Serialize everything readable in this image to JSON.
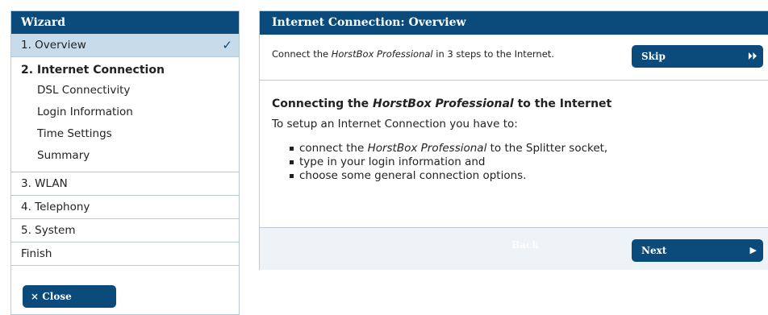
{
  "wizard": {
    "title": "Wizard",
    "steps": [
      {
        "label": "1. Overview",
        "check": "✓"
      },
      {
        "label": "2. Internet Connection",
        "subs": [
          "DSL Connectivity",
          "Login Information",
          "Time Settings",
          "Summary"
        ]
      },
      {
        "label": "3. WLAN"
      },
      {
        "label": "4. Telephony"
      },
      {
        "label": "5. System"
      },
      {
        "label": "Finish"
      }
    ],
    "close_label": "× Close"
  },
  "main": {
    "title": "Internet Connection: Overview",
    "intro_prefix": "Connect the ",
    "intro_product": "HorstBox Professional",
    "intro_suffix": " in 3 steps to the Internet.",
    "skip_label": "Skip",
    "skip_arrow": "⏵⏵",
    "heading_prefix": "Connecting the ",
    "heading_product": "HorstBox Professional",
    "heading_suffix": " to the Internet",
    "lead": "To setup an Internet Connection you have to:",
    "bullets": [
      {
        "prefix": "connect the ",
        "em": "HorstBox Professional",
        "suffix": " to the Splitter socket,"
      },
      {
        "prefix": "type in your login information and",
        "em": "",
        "suffix": ""
      },
      {
        "prefix": "choose some general connection options.",
        "em": "",
        "suffix": ""
      }
    ],
    "back_label": "Back",
    "next_label": "Next",
    "next_arrow": "▶"
  }
}
